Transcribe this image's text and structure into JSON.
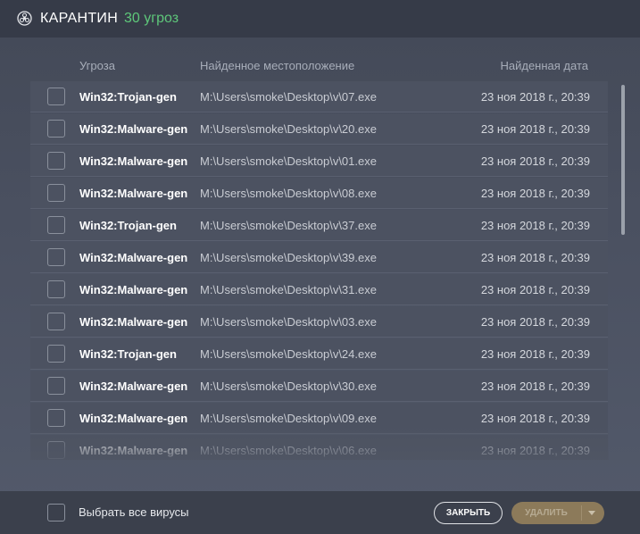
{
  "header": {
    "title": "КАРАНТИН",
    "count": "30 угроз"
  },
  "columns": {
    "threat": "Угроза",
    "location": "Найденное местоположение",
    "date": "Найденная дата"
  },
  "rows": [
    {
      "name": "Win32:Trojan-gen",
      "path": "M:\\Users\\smoke\\Desktop\\v\\07.exe",
      "date": "23 ноя 2018 г., 20:39"
    },
    {
      "name": "Win32:Malware-gen",
      "path": "M:\\Users\\smoke\\Desktop\\v\\20.exe",
      "date": "23 ноя 2018 г., 20:39"
    },
    {
      "name": "Win32:Malware-gen",
      "path": "M:\\Users\\smoke\\Desktop\\v\\01.exe",
      "date": "23 ноя 2018 г., 20:39"
    },
    {
      "name": "Win32:Malware-gen",
      "path": "M:\\Users\\smoke\\Desktop\\v\\08.exe",
      "date": "23 ноя 2018 г., 20:39"
    },
    {
      "name": "Win32:Trojan-gen",
      "path": "M:\\Users\\smoke\\Desktop\\v\\37.exe",
      "date": "23 ноя 2018 г., 20:39"
    },
    {
      "name": "Win32:Malware-gen",
      "path": "M:\\Users\\smoke\\Desktop\\v\\39.exe",
      "date": "23 ноя 2018 г., 20:39"
    },
    {
      "name": "Win32:Malware-gen",
      "path": "M:\\Users\\smoke\\Desktop\\v\\31.exe",
      "date": "23 ноя 2018 г., 20:39"
    },
    {
      "name": "Win32:Malware-gen",
      "path": "M:\\Users\\smoke\\Desktop\\v\\03.exe",
      "date": "23 ноя 2018 г., 20:39"
    },
    {
      "name": "Win32:Trojan-gen",
      "path": "M:\\Users\\smoke\\Desktop\\v\\24.exe",
      "date": "23 ноя 2018 г., 20:39"
    },
    {
      "name": "Win32:Malware-gen",
      "path": "M:\\Users\\smoke\\Desktop\\v\\30.exe",
      "date": "23 ноя 2018 г., 20:39"
    },
    {
      "name": "Win32:Malware-gen",
      "path": "M:\\Users\\smoke\\Desktop\\v\\09.exe",
      "date": "23 ноя 2018 г., 20:39"
    },
    {
      "name": "Win32:Malware-gen",
      "path": "M:\\Users\\smoke\\Desktop\\v\\06.exe",
      "date": "23 ноя 2018 г., 20:39"
    }
  ],
  "footer": {
    "select_all_label": "Выбрать все вирусы",
    "close_label": "ЗАКРЫТЬ",
    "delete_label": "УДАЛИТЬ"
  },
  "colors": {
    "accent_green": "#5ec77a",
    "delete_button": "#8c7a5a"
  },
  "icons": {
    "title": "biohazard-icon",
    "delete_dropdown": "chevron-down-icon"
  }
}
